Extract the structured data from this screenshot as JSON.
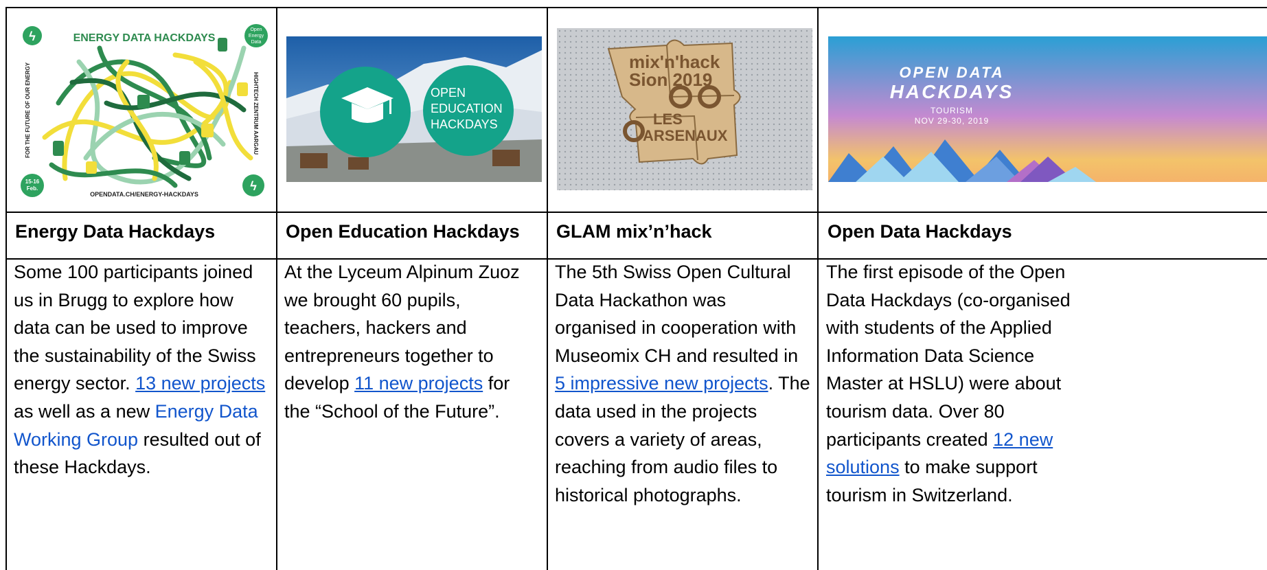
{
  "columns": [
    {
      "image": {
        "title": "ENERGY DATA HACKDAYS",
        "left_text": "FOR THE FUTURE OF OUR ENERGY",
        "right_text": "HIGHTECH ZENTRUM AARGAU",
        "footer": "OPENDATA.CH/ENERGY-HACKDAYS",
        "badge_top_right": [
          "Open",
          "Energy",
          "Data"
        ],
        "badge_bottom_left": [
          "15-16",
          "Feb."
        ]
      },
      "title": "Energy Data Hackdays",
      "body": {
        "t1": "Some 100 participants joined us in Brugg to explore how data can be used to improve the sustainability of the Swiss energy sector. ",
        "link1": "13 new projects",
        "t2": " as well as a new ",
        "link2": "Energy Data Working Group",
        "t3": " resulted out of these Hackdays."
      }
    },
    {
      "image": {
        "text": [
          "OPEN",
          "EDUCATION",
          "HACKDAYS"
        ]
      },
      "title": "Open Education Hackdays",
      "body": {
        "t1": "At the Lyceum Alpinum Zuoz we brought 60 pupils, teachers, hackers and entrepreneurs together to develop ",
        "link1": "11 new projects",
        "t2": " for the “School of the Future”."
      }
    },
    {
      "image": {
        "text": [
          "mix'n'hack",
          "Sion 2019",
          "LES",
          "ARSENAUX"
        ]
      },
      "title": "GLAM mix’n’hack",
      "body": {
        "t1": "The 5th Swiss Open Cultural Data Hackathon was organised in cooperation with Museomix CH and resulted in ",
        "link1": "5 impressive new projects",
        "t2": ". The data used in the projects covers a variety of areas, reaching from audio files to historical photographs."
      }
    },
    {
      "image": {
        "line1": "OPEN DATA",
        "line2": "HACKDAYS",
        "line3": "TOURISM",
        "line4": "NOV 29-30, 2019"
      },
      "title": "Open Data Hackdays",
      "body": {
        "t1": "The first episode of the Open Data Hackdays (co-organised with students of the Applied Information Data Science Master at HSLU) were about tourism data. Over 80 participants created ",
        "link1": "12 new solutions",
        "t2": " to make support tourism in Switzerland."
      }
    }
  ]
}
